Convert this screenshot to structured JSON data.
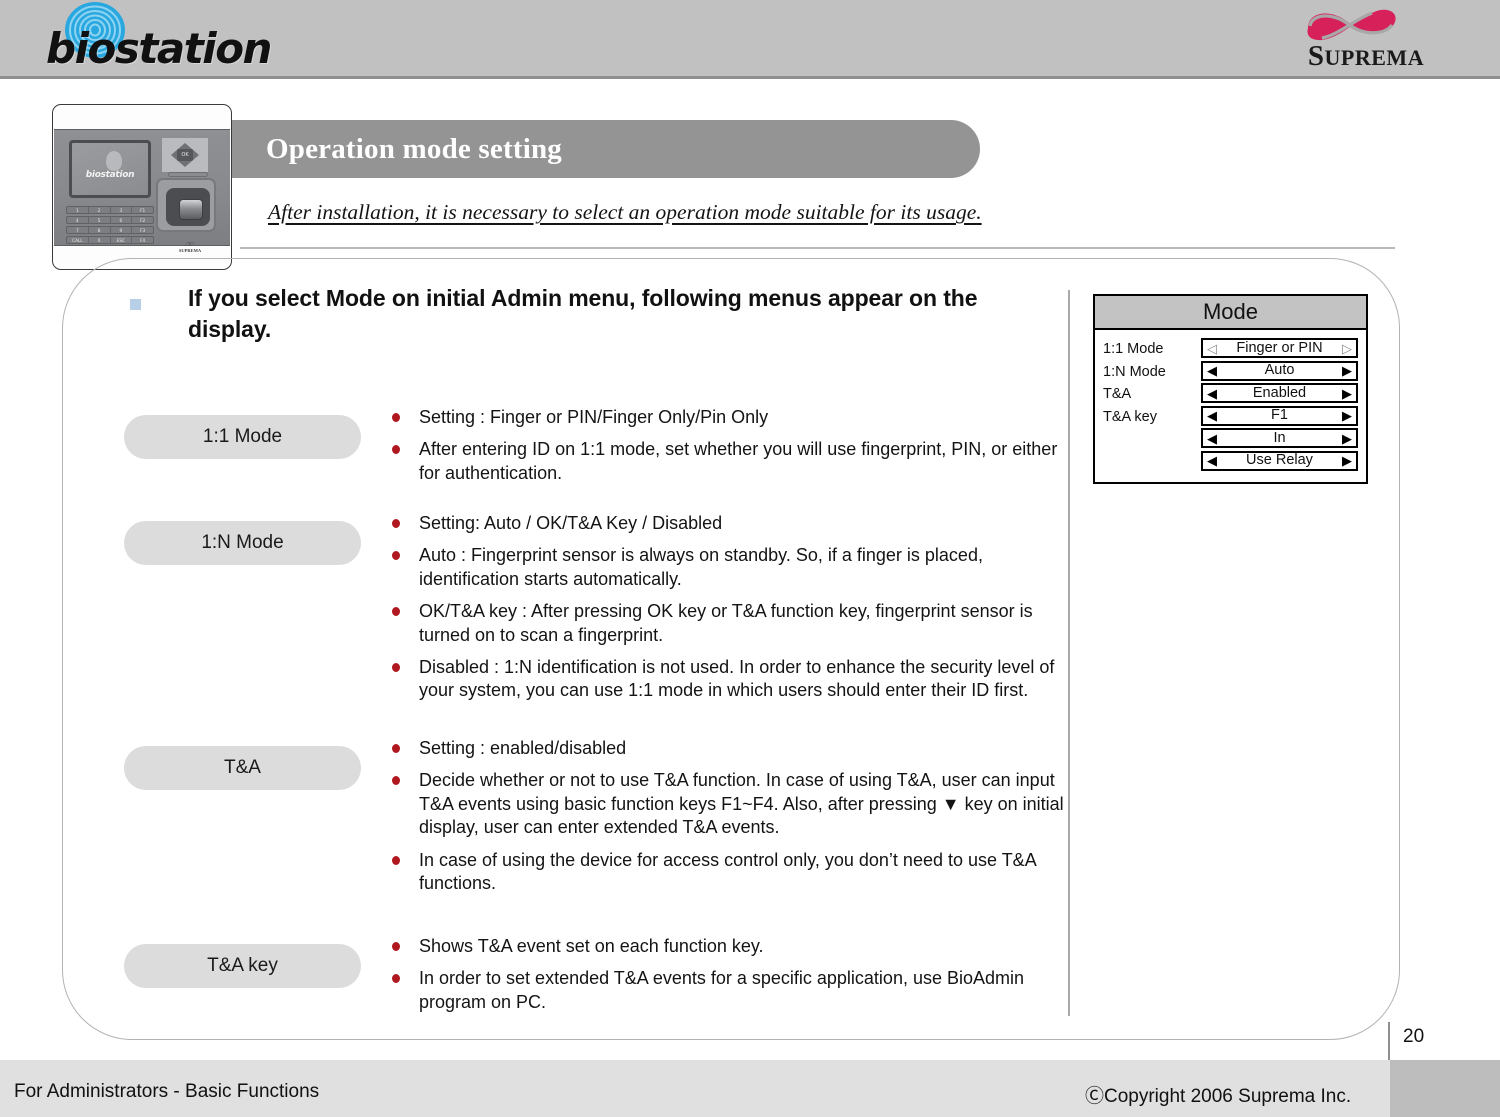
{
  "header": {
    "product_logo_text": "biostation",
    "company_logo_text": "SUPREMA",
    "company_logo_text_first": "S",
    "company_logo_text_rest": "UPREMA"
  },
  "title_banner": {
    "title": "Operation mode setting"
  },
  "subtitle": {
    "text": "After installation, it is necessary to select  an operation mode suitable for its usage."
  },
  "device": {
    "screen_label": "biostation",
    "dpad_ok": "OK",
    "brand": "SUPREMA",
    "keypad_rows": [
      [
        "1",
        "2",
        "3",
        "F1"
      ],
      [
        "4",
        "5",
        "6",
        "F2"
      ],
      [
        "7",
        "8",
        "9",
        "F3"
      ],
      [
        "CALL",
        "0",
        "ESC",
        "F4"
      ]
    ]
  },
  "intro": {
    "text": "If  you select Mode on initial Admin menu, following menus appear on the display."
  },
  "sections": [
    {
      "label": "1:1 Mode",
      "bullets": [
        "Setting : Finger or PIN/Finger Only/Pin Only",
        "After entering ID on 1:1 mode, set whether you will use fingerprint, PIN, or either for authentication."
      ]
    },
    {
      "label": "1:N Mode",
      "bullets": [
        "Setting: Auto / OK/T&A Key / Disabled",
        "Auto : Fingerprint sensor is always on standby. So, if a finger is placed, identification starts automatically.",
        "OK/T&A key : After pressing OK key or T&A function key, fingerprint sensor is turned on to scan a fingerprint.",
        "Disabled : 1:N identification is not used. In order to enhance the security level of your system, you can use 1:1 mode in which users should enter their ID first."
      ]
    },
    {
      "label": "T&A",
      "bullets": [
        "Setting : enabled/disabled",
        "Decide whether or not to use T&A function. In case of using T&A, user can input T&A events using basic function keys F1~F4. Also, after pressing ▼ key on initial display, user can enter extended T&A events.",
        "In case of using the device for access control only, you don’t need to use T&A functions."
      ]
    },
    {
      "label": "T&A key",
      "bullets": [
        "Shows T&A event set on each function key.",
        "In order to set extended T&A events for a specific application, use BioAdmin program on PC."
      ]
    }
  ],
  "mode_panel": {
    "title": "Mode",
    "labels": [
      "1:1 Mode",
      "1:N Mode",
      "T&A",
      "T&A key"
    ],
    "rows": [
      {
        "value": "Finger or PIN",
        "left_arrow": "◁",
        "right_arrow": "▷",
        "style": "hollow"
      },
      {
        "value": "Auto",
        "left_arrow": "◀",
        "right_arrow": "▶",
        "style": "filled"
      },
      {
        "value": "Enabled",
        "left_arrow": "◀",
        "right_arrow": "▶",
        "style": "filled"
      },
      {
        "value": "F1",
        "left_arrow": "◀",
        "right_arrow": "▶",
        "style": "filled"
      },
      {
        "value": "In",
        "left_arrow": "◀",
        "right_arrow": "▶",
        "style": "filled"
      },
      {
        "value": "Use Relay",
        "left_arrow": "◀",
        "right_arrow": "▶",
        "style": "filled"
      }
    ]
  },
  "page_number": "20",
  "footer": {
    "left": "For Administrators - Basic Functions",
    "right": "ⒸCopyright 2006 Suprema Inc."
  },
  "colors": {
    "header_band": "#c1c1c1",
    "title_banner": "#949494",
    "pill": "#dcdcdc",
    "bullet_red": "#b01820",
    "square_bullet_blue": "#b7d0e8",
    "suprema_red": "#d6215a",
    "biostation_blue": "#29a8e0",
    "footer": "#e0e0e0"
  }
}
